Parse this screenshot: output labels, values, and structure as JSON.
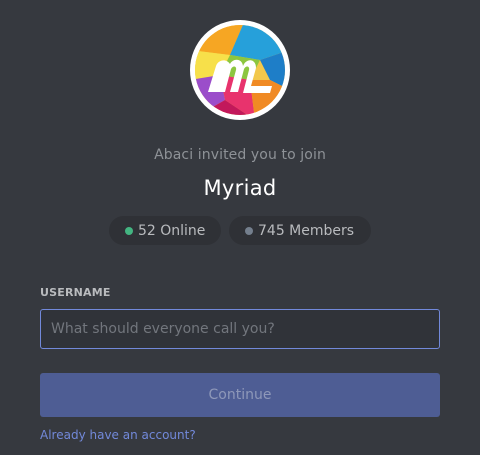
{
  "invite": {
    "inviter_text": "Abaci invited you to join",
    "server_name": "Myriad",
    "logo_icon": "myriad-logo-icon"
  },
  "stats": {
    "online_label": "52 Online",
    "members_label": "745 Members",
    "online_color": "#43b581",
    "members_color": "#747f8d"
  },
  "form": {
    "username_label": "USERNAME",
    "username_placeholder": "What should everyone call you?",
    "username_value": "",
    "continue_label": "Continue",
    "login_link": "Already have an account?"
  },
  "colors": {
    "background": "#36393f",
    "accent": "#7289da",
    "button_disabled": "#4e5d94",
    "pill_background": "#2f3136"
  }
}
